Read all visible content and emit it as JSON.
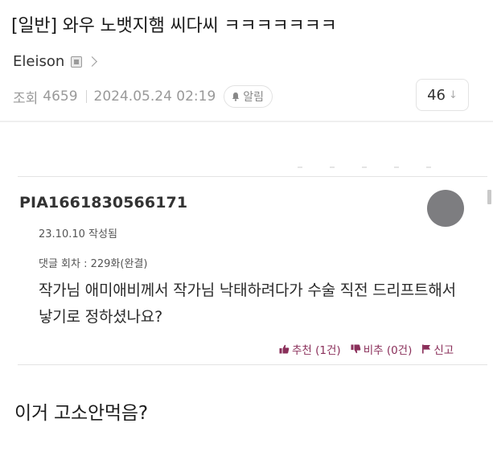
{
  "post": {
    "title": "[일반] 와우 노뱃지햄 씨다씨 ㅋㅋㅋㅋㅋㅋㅋ",
    "author": "Eleison",
    "views_label": "조회",
    "views": "4659",
    "datetime": "2024.05.24 02:19",
    "alarm_label": "알림",
    "comment_count": "46",
    "comment_count_arrow": "↓"
  },
  "comment": {
    "user": "PIA1661830566171",
    "date": "23.10.10 작성됨",
    "episode": "댓글 회차 : 229화(완결)",
    "body": "작가님 애미애비께서 작가님 낙태하려다가 수술 직전 드리프트해서 낳기로 정하셨나요?",
    "actions": {
      "recommend": "추천 (1건)",
      "not_recommend": "비추 (0건)",
      "report": "신고"
    }
  },
  "caption": "이거 고소안먹음?",
  "colors": {
    "action_accent": "#8a2f5a",
    "avatar": "#7d7d80",
    "muted_text": "#999999"
  },
  "icons": {
    "badge": "badge-icon",
    "chevron": "chevron-right-icon",
    "bell": "bell-icon",
    "down_arrow": "down-arrow-icon",
    "thumbs_up": "thumbs-up-icon",
    "thumbs_down": "thumbs-down-icon",
    "report": "report-flag-icon"
  }
}
